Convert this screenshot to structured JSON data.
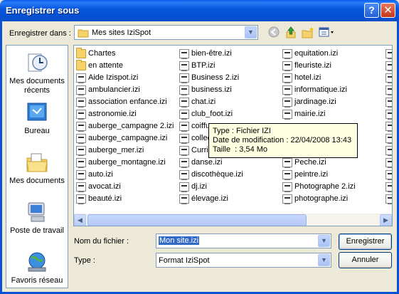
{
  "window": {
    "title": "Enregistrer sous"
  },
  "save_in": {
    "label": "Enregistrer dans :",
    "value": "Mes sites IziSpot"
  },
  "toolbar": {
    "back_icon": "back-icon",
    "up_icon": "up-folder-icon",
    "new_folder_icon": "new-folder-icon",
    "views_icon": "views-menu-icon"
  },
  "places": [
    {
      "label": "Mes documents récents",
      "icon": "recent-documents-icon"
    },
    {
      "label": "Bureau",
      "icon": "desktop-icon"
    },
    {
      "label": "Mes documents",
      "icon": "my-documents-icon"
    },
    {
      "label": "Poste de travail",
      "icon": "my-computer-icon"
    },
    {
      "label": "Favoris réseau",
      "icon": "network-places-icon"
    }
  ],
  "files": {
    "col1": [
      {
        "name": "Chartes",
        "type": "folder"
      },
      {
        "name": "en attente",
        "type": "folder"
      },
      {
        "name": "Aide Izispot.izi",
        "type": "izi"
      },
      {
        "name": "ambulancier.izi",
        "type": "izi"
      },
      {
        "name": "association enfance.izi",
        "type": "izi"
      },
      {
        "name": "astronomie.izi",
        "type": "izi"
      },
      {
        "name": "auberge_campagne 2.izi",
        "type": "izi"
      },
      {
        "name": "auberge_campagne.izi",
        "type": "izi"
      },
      {
        "name": "auberge_mer.izi",
        "type": "izi"
      },
      {
        "name": "auberge_montagne.izi",
        "type": "izi"
      },
      {
        "name": "auto.izi",
        "type": "izi"
      },
      {
        "name": "avocat.izi",
        "type": "izi"
      },
      {
        "name": "beauté.izi",
        "type": "izi"
      }
    ],
    "col2": [
      {
        "name": "bien-être.izi",
        "type": "izi"
      },
      {
        "name": "BTP.izi",
        "type": "izi"
      },
      {
        "name": "Business 2.izi",
        "type": "izi"
      },
      {
        "name": "business.izi",
        "type": "izi"
      },
      {
        "name": "chat.izi",
        "type": "izi"
      },
      {
        "name": "club_foot.izi",
        "type": "izi"
      },
      {
        "name": "coiffu",
        "type": "izi"
      },
      {
        "name": "collec",
        "type": "izi"
      },
      {
        "name": "Curric",
        "type": "izi"
      },
      {
        "name": "danse.izi",
        "type": "izi"
      },
      {
        "name": "discothèque.izi",
        "type": "izi"
      },
      {
        "name": "dj.izi",
        "type": "izi"
      },
      {
        "name": "élevage.izi",
        "type": "izi"
      }
    ],
    "col3": [
      {
        "name": "equitation.izi",
        "type": "izi"
      },
      {
        "name": "fleuriste.izi",
        "type": "izi"
      },
      {
        "name": "hotel.izi",
        "type": "izi"
      },
      {
        "name": "informatique.izi",
        "type": "izi"
      },
      {
        "name": "jardinage.izi",
        "type": "izi"
      },
      {
        "name": "mairie.izi",
        "type": "izi"
      },
      {
        "name": "",
        "type": "hidden"
      },
      {
        "name": "",
        "type": "hidden"
      },
      {
        "name": "",
        "type": "hidden"
      },
      {
        "name": "Peche.izi",
        "type": "izi"
      },
      {
        "name": "peintre.izi",
        "type": "izi"
      },
      {
        "name": "Photographe 2.izi",
        "type": "izi"
      },
      {
        "name": "photographe.izi",
        "type": "izi"
      }
    ]
  },
  "tooltip": {
    "type": "Type : Fichier IZI",
    "modified": "Date de modification : 22/04/2008 13:43",
    "size": "Taille  : 3,54 Mo"
  },
  "filename": {
    "label": "Nom du fichier :",
    "value": "Mon site.izi"
  },
  "filetype": {
    "label": "Type :",
    "value": "Format IziSpot"
  },
  "buttons": {
    "save": "Enregistrer",
    "cancel": "Annuler"
  },
  "colors": {
    "title_bar": "#0A58DE",
    "selection": "#316AC5",
    "tooltip_bg": "#FFFFE1"
  }
}
